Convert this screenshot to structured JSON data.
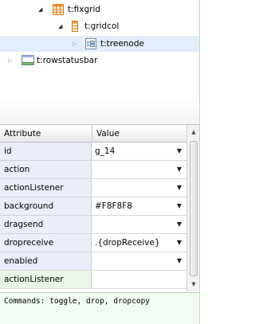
{
  "tree": {
    "nodes": [
      {
        "label": "t:fixgrid",
        "icon": "grid-icon",
        "expanded": true
      },
      {
        "label": "t:gridcol",
        "icon": "column-icon",
        "expanded": true
      },
      {
        "label": "t:treenode",
        "icon": "treenode-icon",
        "expanded": false,
        "selected": true
      },
      {
        "label": "t:rowstatusbar",
        "icon": "statusbar-icon",
        "expanded": false
      }
    ]
  },
  "table": {
    "headers": [
      "Attribute",
      "Value"
    ],
    "rows": [
      {
        "attr": "id",
        "value": "g_14"
      },
      {
        "attr": "action",
        "value": ""
      },
      {
        "attr": "actionListener",
        "value": ""
      },
      {
        "attr": "background",
        "value": "#F8F8F8"
      },
      {
        "attr": "dragsend",
        "value": ""
      },
      {
        "attr": "dropreceive",
        "value": ".{dropReceive}"
      },
      {
        "attr": "enabled",
        "value": ""
      },
      {
        "attr": "actionListener",
        "value": ""
      }
    ]
  },
  "commands": {
    "text": "Commands: toggle, drop, dropcopy"
  },
  "colors": {
    "selected_row": "#e3eefb",
    "attr_cell": "#ecedfa",
    "new_row": "#eaf6e9",
    "commands_bg": "#f2fbf1"
  }
}
